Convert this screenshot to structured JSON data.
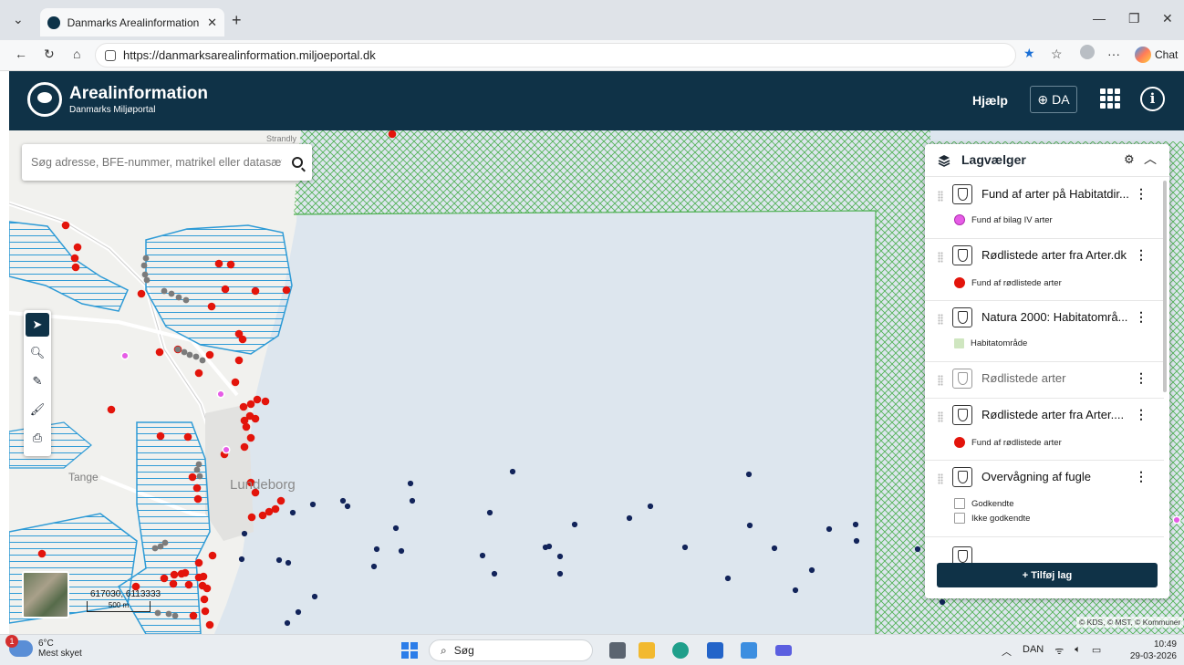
{
  "browser": {
    "tab_title": "Danmarks Arealinformation - en d",
    "url": "https://danmarksarealinformation.miljoeportal.dk",
    "chat_label": "Chat",
    "new_tab": "+",
    "menu_dots": "···"
  },
  "header": {
    "title": "Arealinformation",
    "subtitle": "Danmarks Miljøportal",
    "help_label": "Hjælp",
    "language_label": "DA"
  },
  "map": {
    "search_placeholder": "Søg adresse, BFE-nummer, matrikel eller datasæt",
    "coordinates": "617030, 6113333",
    "scale_label": "500 m",
    "attribution": "© KDS, © MST, © Kommuner",
    "places": {
      "lundeborg": "Lundeborg",
      "tange": "Tange",
      "strandly": "Strandly"
    },
    "colors": {
      "sea": "#dde6ee",
      "natura": "#4caf50",
      "habitat_lines": "#2f9bd6",
      "red_dot": "#e3140b",
      "navy_dot": "#12245a",
      "magenta_dot": "#e65ce6",
      "grey_dot": "#7b7b7b"
    }
  },
  "toolbar": {
    "tools": [
      "select-icon",
      "zoom-icon",
      "measure-icon",
      "draw-icon",
      "print-icon"
    ]
  },
  "layer_panel": {
    "title": "Lagvælger",
    "layers": [
      {
        "name": "Fund af arter på Habitatdir...",
        "legend": "Fund af bilag IV arter",
        "legend_color": "#e65ce6"
      },
      {
        "name": "Rødlistede arter fra Arter.dk",
        "legend": "Fund af rødlistede arter",
        "legend_color": "#e3140b"
      },
      {
        "name": "Natura 2000: Habitatområ...",
        "legend": "Habitatområde",
        "legend_color": "#cfe6c0"
      },
      {
        "name": "Rødlistede arter",
        "legend": "",
        "legend_color": ""
      },
      {
        "name": "Rødlistede arter fra Arter....",
        "legend": "Fund af rødlistede arter",
        "legend_color": "#e3140b"
      },
      {
        "name": "Overvågning af fugle",
        "legend": "Godkendte",
        "legend2": "Ikke godkendte"
      }
    ],
    "add_layer_label": "+ Tilføj lag"
  },
  "taskbar": {
    "weather_temp": "6°C",
    "weather_desc": "Mest skyet",
    "weather_badge": "1",
    "search_label": "Søg",
    "language": "DAN",
    "time": "10:49",
    "date": "29-03-2026"
  }
}
